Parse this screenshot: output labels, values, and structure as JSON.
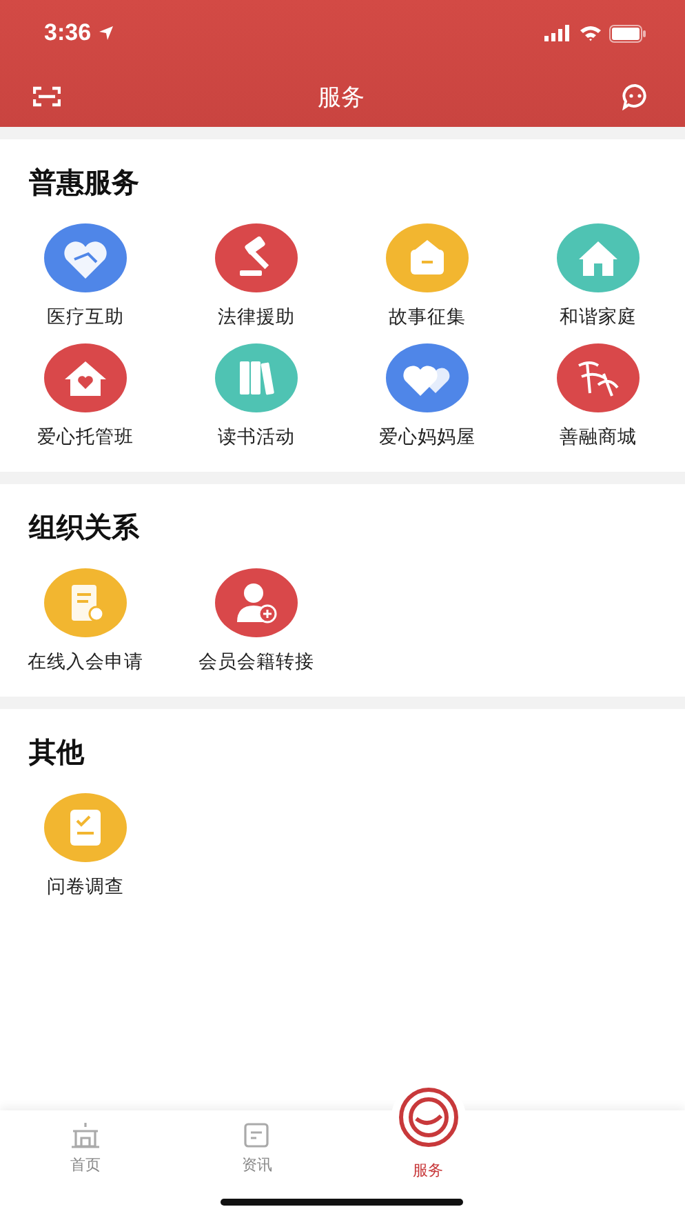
{
  "status_bar": {
    "time": "3:36"
  },
  "header": {
    "title": "服务"
  },
  "sections": [
    {
      "title": "普惠服务",
      "items": [
        {
          "label": "医疗互助",
          "kind": "handshake",
          "color": "#4f86e8"
        },
        {
          "label": "法律援助",
          "kind": "gavel",
          "color": "#d9484a"
        },
        {
          "label": "故事征集",
          "kind": "card",
          "color": "#f2b630"
        },
        {
          "label": "和谐家庭",
          "kind": "house",
          "color": "#4fc3b3"
        },
        {
          "label": "爱心托管班",
          "kind": "heart-house",
          "color": "#d9484a"
        },
        {
          "label": "读书活动",
          "kind": "books",
          "color": "#4fc3b3"
        },
        {
          "label": "爱心妈妈屋",
          "kind": "hearts",
          "color": "#4f86e8"
        },
        {
          "label": "善融商城",
          "kind": "script",
          "color": "#d9484a"
        }
      ]
    },
    {
      "title": "组织关系",
      "items": [
        {
          "label": "在线入会申请",
          "kind": "form",
          "color": "#f2b630"
        },
        {
          "label": "会员会籍转接",
          "kind": "person",
          "color": "#d9484a"
        }
      ]
    },
    {
      "title": "其他",
      "items": [
        {
          "label": "问卷调查",
          "kind": "survey",
          "color": "#f2b630"
        }
      ]
    }
  ],
  "tabs": [
    {
      "label": "首页",
      "kind": "home",
      "selected": false
    },
    {
      "label": "资讯",
      "kind": "news",
      "selected": false
    },
    {
      "label": "服务",
      "kind": "service",
      "selected": true
    }
  ]
}
